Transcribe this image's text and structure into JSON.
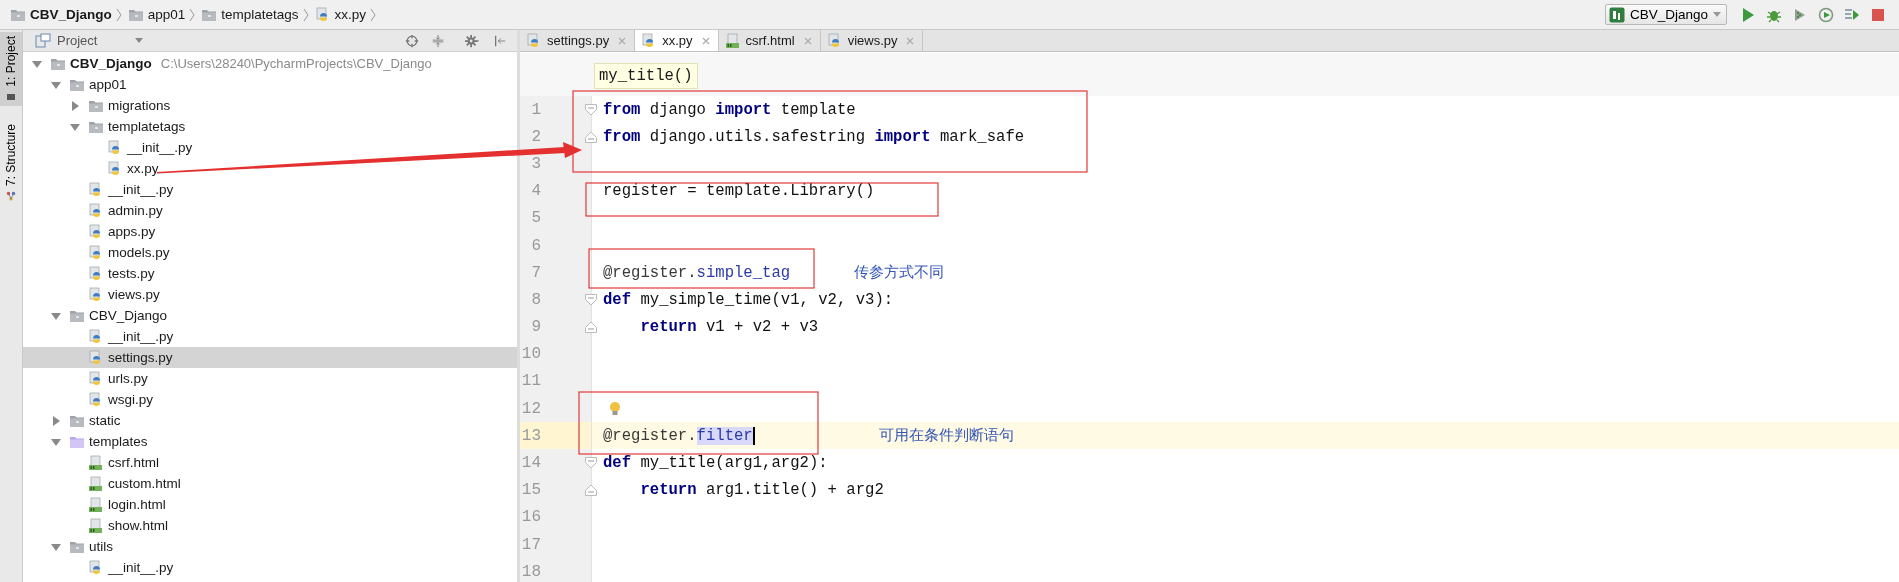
{
  "breadcrumbs": [
    {
      "label": "CBV_Django",
      "kind": "folder"
    },
    {
      "label": "app01",
      "kind": "folder"
    },
    {
      "label": "templatetags",
      "kind": "folder"
    },
    {
      "label": "xx.py",
      "kind": "python"
    }
  ],
  "run_config": {
    "label": "CBV_Django"
  },
  "side_tabs": [
    {
      "label": "1: Project",
      "kind": "project",
      "selected": true
    },
    {
      "label": "7: Structure",
      "kind": "structure",
      "selected": false
    }
  ],
  "project_panel": {
    "title": "Project",
    "tree": [
      {
        "label": "CBV_Django",
        "kind": "folder",
        "path": "C:\\Users\\28240\\PycharmProjects\\CBV_Django",
        "expanded": true,
        "selected": false,
        "children": [
          {
            "label": "app01",
            "kind": "folder",
            "expanded": true,
            "selected": false,
            "children": [
              {
                "label": "migrations",
                "kind": "folder",
                "expanded": false,
                "selected": false
              },
              {
                "label": "templatetags",
                "kind": "folder",
                "expanded": true,
                "selected": false,
                "children": [
                  {
                    "label": "__init__.py",
                    "kind": "python",
                    "selected": false
                  },
                  {
                    "label": "xx.py",
                    "kind": "python",
                    "selected": false
                  }
                ]
              },
              {
                "label": "__init__.py",
                "kind": "python",
                "selected": false
              },
              {
                "label": "admin.py",
                "kind": "python",
                "selected": false
              },
              {
                "label": "apps.py",
                "kind": "python",
                "selected": false
              },
              {
                "label": "models.py",
                "kind": "python",
                "selected": false
              },
              {
                "label": "tests.py",
                "kind": "python",
                "selected": false
              },
              {
                "label": "views.py",
                "kind": "python",
                "selected": false
              }
            ]
          },
          {
            "label": "CBV_Django",
            "kind": "folder",
            "expanded": true,
            "selected": false,
            "children": [
              {
                "label": "__init__.py",
                "kind": "python",
                "selected": false
              },
              {
                "label": "settings.py",
                "kind": "python",
                "selected": true
              },
              {
                "label": "urls.py",
                "kind": "python",
                "selected": false
              },
              {
                "label": "wsgi.py",
                "kind": "python",
                "selected": false
              }
            ]
          },
          {
            "label": "static",
            "kind": "folder",
            "expanded": false,
            "selected": false
          },
          {
            "label": "templates",
            "kind": "template_folder",
            "expanded": true,
            "selected": false,
            "children": [
              {
                "label": "csrf.html",
                "kind": "html",
                "selected": false
              },
              {
                "label": "custom.html",
                "kind": "html",
                "selected": false
              },
              {
                "label": "login.html",
                "kind": "html",
                "selected": false
              },
              {
                "label": "show.html",
                "kind": "html",
                "selected": false
              }
            ]
          },
          {
            "label": "utils",
            "kind": "folder",
            "expanded": true,
            "selected": false,
            "children": [
              {
                "label": "__init__.py",
                "kind": "python",
                "selected": false
              }
            ]
          }
        ]
      }
    ]
  },
  "tabs": [
    {
      "label": "settings.py",
      "kind": "python",
      "selected": false
    },
    {
      "label": "xx.py",
      "kind": "python",
      "selected": true
    },
    {
      "label": "csrf.html",
      "kind": "html",
      "selected": false
    },
    {
      "label": "views.py",
      "kind": "python",
      "selected": false
    }
  ],
  "hint": "my_title()",
  "code_lines": [
    {
      "number": "1",
      "current": false,
      "kind": "fold_start",
      "tokens": [
        {
          "text": "from",
          "kind": "keyword"
        },
        {
          "text": " django ",
          "kind": "plain"
        },
        {
          "text": "import",
          "kind": "keyword"
        },
        {
          "text": " template",
          "kind": "plain"
        }
      ]
    },
    {
      "number": "2",
      "current": false,
      "kind": "fold_end",
      "tokens": [
        {
          "text": "from",
          "kind": "keyword"
        },
        {
          "text": " django.utils.safestring ",
          "kind": "plain"
        },
        {
          "text": "import",
          "kind": "keyword"
        },
        {
          "text": " mark_safe",
          "kind": "plain"
        }
      ]
    },
    {
      "number": "3",
      "current": false,
      "kind": "plain"
    },
    {
      "number": "4",
      "current": false,
      "kind": "plain",
      "tokens": [
        {
          "text": "register = template.Library()",
          "kind": "plain"
        }
      ]
    },
    {
      "number": "5",
      "current": false,
      "kind": "plain"
    },
    {
      "number": "6",
      "current": false,
      "kind": "plain"
    },
    {
      "number": "7",
      "current": false,
      "kind": "plain",
      "note": "传参方式不同",
      "tokens": [
        {
          "text": "@register.",
          "kind": "decorator"
        },
        {
          "text": "simple_tag",
          "kind": "decorator_name"
        }
      ]
    },
    {
      "number": "8",
      "current": false,
      "kind": "fold_start",
      "tokens": [
        {
          "text": "def",
          "kind": "keyword"
        },
        {
          "text": " my_simple_time(v1, v2, v3):",
          "kind": "plain"
        }
      ]
    },
    {
      "number": "9",
      "current": false,
      "kind": "fold_end",
      "tokens": [
        {
          "text": "    return",
          "kind": "keyword"
        },
        {
          "text": " v1 + v2 + v3",
          "kind": "plain"
        }
      ]
    },
    {
      "number": "10",
      "current": false,
      "kind": "plain"
    },
    {
      "number": "11",
      "current": false,
      "kind": "plain"
    },
    {
      "number": "12",
      "current": false,
      "kind": "bulb"
    },
    {
      "number": "13",
      "current": true,
      "kind": "plain",
      "note": "可用在条件判断语句",
      "tokens": [
        {
          "text": "@register.",
          "kind": "decorator"
        },
        {
          "text": "filter",
          "kind": "selection"
        }
      ]
    },
    {
      "number": "14",
      "current": false,
      "kind": "fold_start",
      "tokens": [
        {
          "text": "def",
          "kind": "keyword"
        },
        {
          "text": " my_title(arg1,arg2):",
          "kind": "plain"
        }
      ]
    },
    {
      "number": "15",
      "current": false,
      "kind": "fold_end",
      "tokens": [
        {
          "text": "    return",
          "kind": "keyword"
        },
        {
          "text": " arg1.title() + arg2",
          "kind": "plain"
        }
      ]
    },
    {
      "number": "16",
      "current": false,
      "kind": "plain"
    },
    {
      "number": "17",
      "current": false,
      "kind": "plain"
    },
    {
      "number": "18",
      "current": false,
      "kind": "plain"
    }
  ]
}
